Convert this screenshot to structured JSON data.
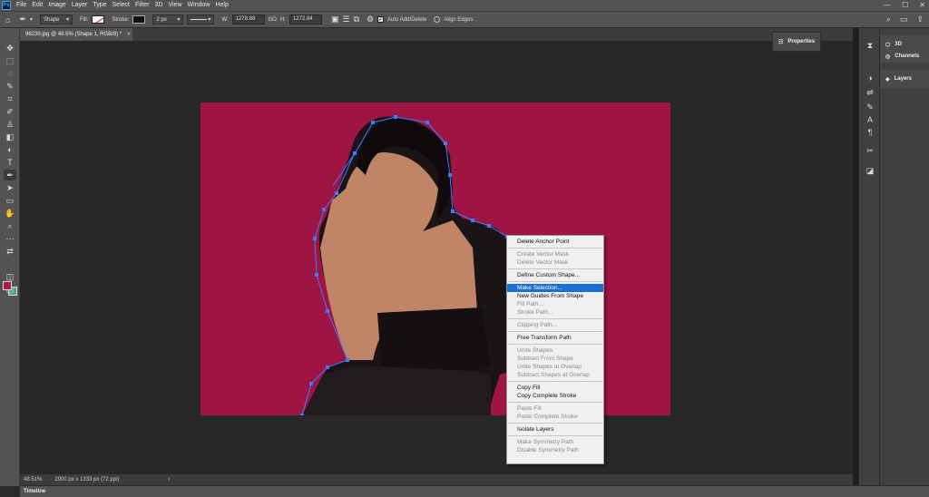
{
  "app": {
    "logo": "Ps"
  },
  "menu": [
    "File",
    "Edit",
    "Image",
    "Layer",
    "Type",
    "Select",
    "Filter",
    "3D",
    "View",
    "Window",
    "Help"
  ],
  "window_controls": {
    "minimize": "—",
    "maximize": "☐",
    "close": "✕"
  },
  "options_bar": {
    "mode": "Shape",
    "fill_label": "Fill:",
    "stroke_label": "Stroke:",
    "stroke_width": "2 px",
    "w_label": "W:",
    "w_value": "1278.88",
    "link_label": "GO",
    "h_label": "H:",
    "h_value": "1272.84",
    "auto_add_delete": "Auto Add/Delete",
    "align_edges": "Align Edges"
  },
  "document_tab": {
    "title": "96239.jpg @ 48.5% (Shape 1, RGB/8) *",
    "close": "×"
  },
  "status": {
    "zoom": "48.51%",
    "doc_info": "2000 px x 1333 px (72 ppi)"
  },
  "timeline_label": "Timeline",
  "panels": {
    "properties": "Properties",
    "three_d": "3D",
    "channels": "Channels",
    "layers": "Layers"
  },
  "colors": {
    "foreground": "#b2193f",
    "background": "#4ea887",
    "canvas_bg": "#9e1544",
    "highlight": "#1b6fd1"
  },
  "context_menu": {
    "groups": [
      [
        {
          "label": "Delete Anchor Point",
          "enabled": true
        }
      ],
      [
        {
          "label": "Create Vector Mask",
          "enabled": false
        },
        {
          "label": "Delete Vector Mask",
          "enabled": false
        }
      ],
      [
        {
          "label": "Define Custom Shape...",
          "enabled": true
        }
      ],
      [
        {
          "label": "Make Selection...",
          "enabled": true,
          "highlighted": true
        },
        {
          "label": "New Guides From Shape",
          "enabled": true
        },
        {
          "label": "Fill Path...",
          "enabled": false
        },
        {
          "label": "Stroke Path...",
          "enabled": false
        }
      ],
      [
        {
          "label": "Clipping Path...",
          "enabled": false
        }
      ],
      [
        {
          "label": "Free Transform Path",
          "enabled": true
        }
      ],
      [
        {
          "label": "Unite Shapes",
          "enabled": false
        },
        {
          "label": "Subtract Front Shape",
          "enabled": false
        },
        {
          "label": "Unite Shapes at Overlap",
          "enabled": false
        },
        {
          "label": "Subtract Shapes at Overlap",
          "enabled": false
        }
      ],
      [
        {
          "label": "Copy Fill",
          "enabled": true
        },
        {
          "label": "Copy Complete Stroke",
          "enabled": true
        }
      ],
      [
        {
          "label": "Paste Fill",
          "enabled": false
        },
        {
          "label": "Paste Complete Stroke",
          "enabled": false
        }
      ],
      [
        {
          "label": "Isolate Layers",
          "enabled": true
        }
      ],
      [
        {
          "label": "Make Symmetry Path",
          "enabled": false
        },
        {
          "label": "Disable Symmetry Path",
          "enabled": false
        }
      ]
    ]
  }
}
